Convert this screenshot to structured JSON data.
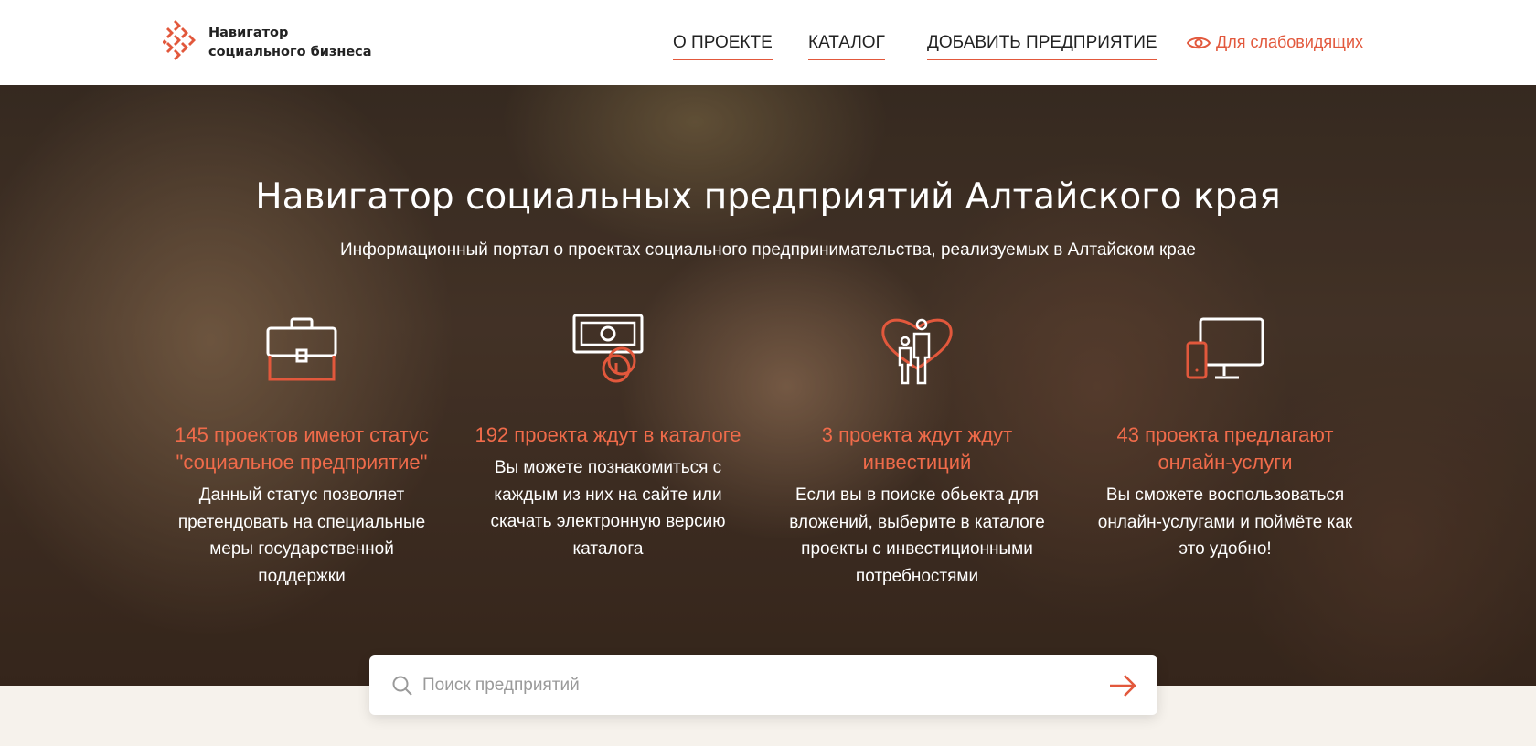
{
  "header": {
    "logo_line1": "Навигатор",
    "logo_line2": "социального бизнеса",
    "nav": [
      "О ПРОЕКТЕ",
      "КАТАЛОГ",
      "ДОБАВИТЬ ПРЕДПРИЯТИЕ"
    ],
    "vision_label": "Для слабовидящих"
  },
  "hero": {
    "title": "Навигатор социальных предприятий Алтайского края",
    "subtitle": "Информационный портал о проектах социального предпринимательства, реализуемых в Алтайском крае",
    "features": [
      {
        "icon": "briefcase-icon",
        "heading": "145 проектов имеют статус \"социальное предприятие\"",
        "text": "Данный статус позволяет претендовать на специальные меры государственной поддержки"
      },
      {
        "icon": "money-icon",
        "heading": "192 проекта ждут в каталоге",
        "text": "Вы можете познакомиться с каждым из них на сайте или скачать электронную версию каталога"
      },
      {
        "icon": "family-heart-icon",
        "heading": "3 проекта ждут ждут инвестиций",
        "text": "Если вы в поиске обьекта для вложений, выберите в каталоге проекты с инвестиционными потребностями"
      },
      {
        "icon": "devices-icon",
        "heading": "43 проекта предлагают онлайн-услуги",
        "text": "Вы сможете воспользоваться онлайн-услугами и поймёте как это удобно!"
      }
    ]
  },
  "search": {
    "placeholder": "Поиск предприятий"
  },
  "colors": {
    "accent": "#e2583c",
    "accent_light": "#f06b4a",
    "page_bg": "#f6f2ec"
  }
}
